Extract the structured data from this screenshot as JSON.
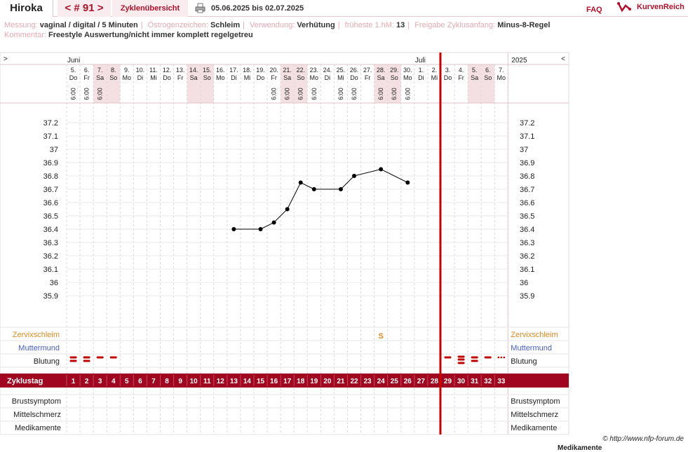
{
  "header": {
    "user": "Hiroka",
    "cycle_prev": "<",
    "cycle_label": "# 91",
    "cycle_next": ">",
    "overview_link": "Zyklenübersicht",
    "date_range": "05.06.2025 bis 02.07.2025",
    "faq": "FAQ",
    "brand": "KurvenReich"
  },
  "meta": {
    "messung_label": "Messung:",
    "messung_value": "vaginal / digital / 5 Minuten",
    "oestrogen_label": "Östrogenzeichen:",
    "oestrogen_value": "Schleim",
    "verwendung_label": "Verwendung:",
    "verwendung_value": "Verhütung",
    "hm_label": "früheste 1.hM:",
    "hm_value": "13",
    "freigabe_label": "Freigabe Zyklusanfang:",
    "freigabe_value": "Minus-8-Regel",
    "kommentar_label": "Kommentar:",
    "kommentar_value": "Freestyle Auswertung/nicht immer komplett regelgetreu"
  },
  "chart_data": {
    "type": "line",
    "nav_left": ">",
    "nav_right": "<",
    "year": "2025",
    "months": [
      {
        "label": "Juni",
        "day_index": 0
      },
      {
        "label": "Juli",
        "day_index": 26
      }
    ],
    "days": [
      {
        "date": "5.",
        "wd": "Do",
        "time": "6:00",
        "weekend": false
      },
      {
        "date": "6.",
        "wd": "Fr",
        "time": "6:00",
        "weekend": false
      },
      {
        "date": "7.",
        "wd": "Sa",
        "time": "6:00",
        "weekend": true
      },
      {
        "date": "8.",
        "wd": "So",
        "time": "",
        "weekend": true
      },
      {
        "date": "9.",
        "wd": "Mo",
        "time": "",
        "weekend": false
      },
      {
        "date": "10.",
        "wd": "Di",
        "time": "",
        "weekend": false
      },
      {
        "date": "11.",
        "wd": "Mi",
        "time": "",
        "weekend": false
      },
      {
        "date": "12.",
        "wd": "Do",
        "time": "",
        "weekend": false
      },
      {
        "date": "13.",
        "wd": "Fr",
        "time": "",
        "weekend": false
      },
      {
        "date": "14.",
        "wd": "Sa",
        "time": "",
        "weekend": true
      },
      {
        "date": "15.",
        "wd": "So",
        "time": "",
        "weekend": true
      },
      {
        "date": "16.",
        "wd": "Mo",
        "time": "",
        "weekend": false
      },
      {
        "date": "17.",
        "wd": "Di",
        "time": "",
        "weekend": false
      },
      {
        "date": "18.",
        "wd": "Mi",
        "time": "",
        "weekend": false
      },
      {
        "date": "19.",
        "wd": "Do",
        "time": "",
        "weekend": false
      },
      {
        "date": "20.",
        "wd": "Fr",
        "time": "6:00",
        "weekend": false
      },
      {
        "date": "21.",
        "wd": "Sa",
        "time": "6:00",
        "weekend": true
      },
      {
        "date": "22.",
        "wd": "So",
        "time": "6:00",
        "weekend": true
      },
      {
        "date": "23.",
        "wd": "Mo",
        "time": "6:00",
        "weekend": false
      },
      {
        "date": "24.",
        "wd": "Di",
        "time": "",
        "weekend": false
      },
      {
        "date": "25.",
        "wd": "Mi",
        "time": "6:00",
        "weekend": false
      },
      {
        "date": "26.",
        "wd": "Do",
        "time": "6:00",
        "weekend": false
      },
      {
        "date": "27.",
        "wd": "Fr",
        "time": "",
        "weekend": false
      },
      {
        "date": "28.",
        "wd": "Sa",
        "time": "6:00",
        "weekend": true
      },
      {
        "date": "29.",
        "wd": "So",
        "time": "6:00",
        "weekend": true
      },
      {
        "date": "30.",
        "wd": "Mo",
        "time": "6:00",
        "weekend": false
      },
      {
        "date": "1.",
        "wd": "Di",
        "time": "",
        "weekend": false
      },
      {
        "date": "2.",
        "wd": "Mi",
        "time": "",
        "weekend": false
      },
      {
        "date": "3.",
        "wd": "Do",
        "time": "",
        "weekend": false
      },
      {
        "date": "4.",
        "wd": "Fr",
        "time": "",
        "weekend": false
      },
      {
        "date": "5.",
        "wd": "Sa",
        "time": "",
        "weekend": true
      },
      {
        "date": "6.",
        "wd": "So",
        "time": "",
        "weekend": true
      },
      {
        "date": "7.",
        "wd": "Mo",
        "time": "",
        "weekend": false
      }
    ],
    "yticks": [
      "37.2",
      "37.1",
      "37",
      "36.9",
      "36.8",
      "36.7",
      "36.6",
      "36.5",
      "36.4",
      "36.3",
      "36.2",
      "36.1",
      "36",
      "35.9"
    ],
    "ylim": [
      35.8,
      37.3
    ],
    "temperature_points": [
      {
        "cycle_day": 13,
        "value": 36.4
      },
      {
        "cycle_day": 15,
        "value": 36.4
      },
      {
        "cycle_day": 16,
        "value": 36.45
      },
      {
        "cycle_day": 17,
        "value": 36.55
      },
      {
        "cycle_day": 18,
        "value": 36.75
      },
      {
        "cycle_day": 19,
        "value": 36.7
      },
      {
        "cycle_day": 21,
        "value": 36.7
      },
      {
        "cycle_day": 22,
        "value": 36.8
      },
      {
        "cycle_day": 24,
        "value": 36.85
      },
      {
        "cycle_day": 26,
        "value": 36.75
      }
    ],
    "cycle_end_day": 28,
    "row_labels": {
      "zervix": "Zervixschleim",
      "muttermund": "Muttermund",
      "blutung": "Blutung",
      "zyklustag": "Zyklustag",
      "brust": "Brustsymptom",
      "mittelschmerz": "Mittelschmerz",
      "medikamente": "Medikamente"
    },
    "zervix_marks": [
      {
        "cycle_day": 24,
        "symbol": "S"
      }
    ],
    "bleeding": [
      {
        "cycle_day": 1,
        "level": "stark"
      },
      {
        "cycle_day": 2,
        "level": "stark"
      },
      {
        "cycle_day": 3,
        "level": "mittel"
      },
      {
        "cycle_day": 4,
        "level": "mittel"
      },
      {
        "cycle_day": 29,
        "level": "mittel"
      },
      {
        "cycle_day": 30,
        "level": "sehr stark"
      },
      {
        "cycle_day": 31,
        "level": "stark"
      },
      {
        "cycle_day": 32,
        "level": "mittel"
      },
      {
        "cycle_day": 33,
        "level": "schmier"
      }
    ],
    "cycle_days": [
      "1",
      "2",
      "3",
      "4",
      "5",
      "6",
      "7",
      "8",
      "9",
      "10",
      "11",
      "12",
      "13",
      "14",
      "15",
      "16",
      "17",
      "18",
      "19",
      "20",
      "21",
      "22",
      "23",
      "24",
      "25",
      "26",
      "27",
      "28",
      "29",
      "30",
      "31",
      "32",
      "33"
    ],
    "colors": {
      "accent": "#a0061f",
      "cycle_line": "#cc0000",
      "weekend": "#f4e0e3",
      "zervix": "#e08a1e",
      "muttermund": "#4a5ccc",
      "bleeding": "#c00000"
    }
  },
  "footer": {
    "copyright": "© http://www.nfp-forum.de",
    "cut_label": "Medikamente"
  }
}
